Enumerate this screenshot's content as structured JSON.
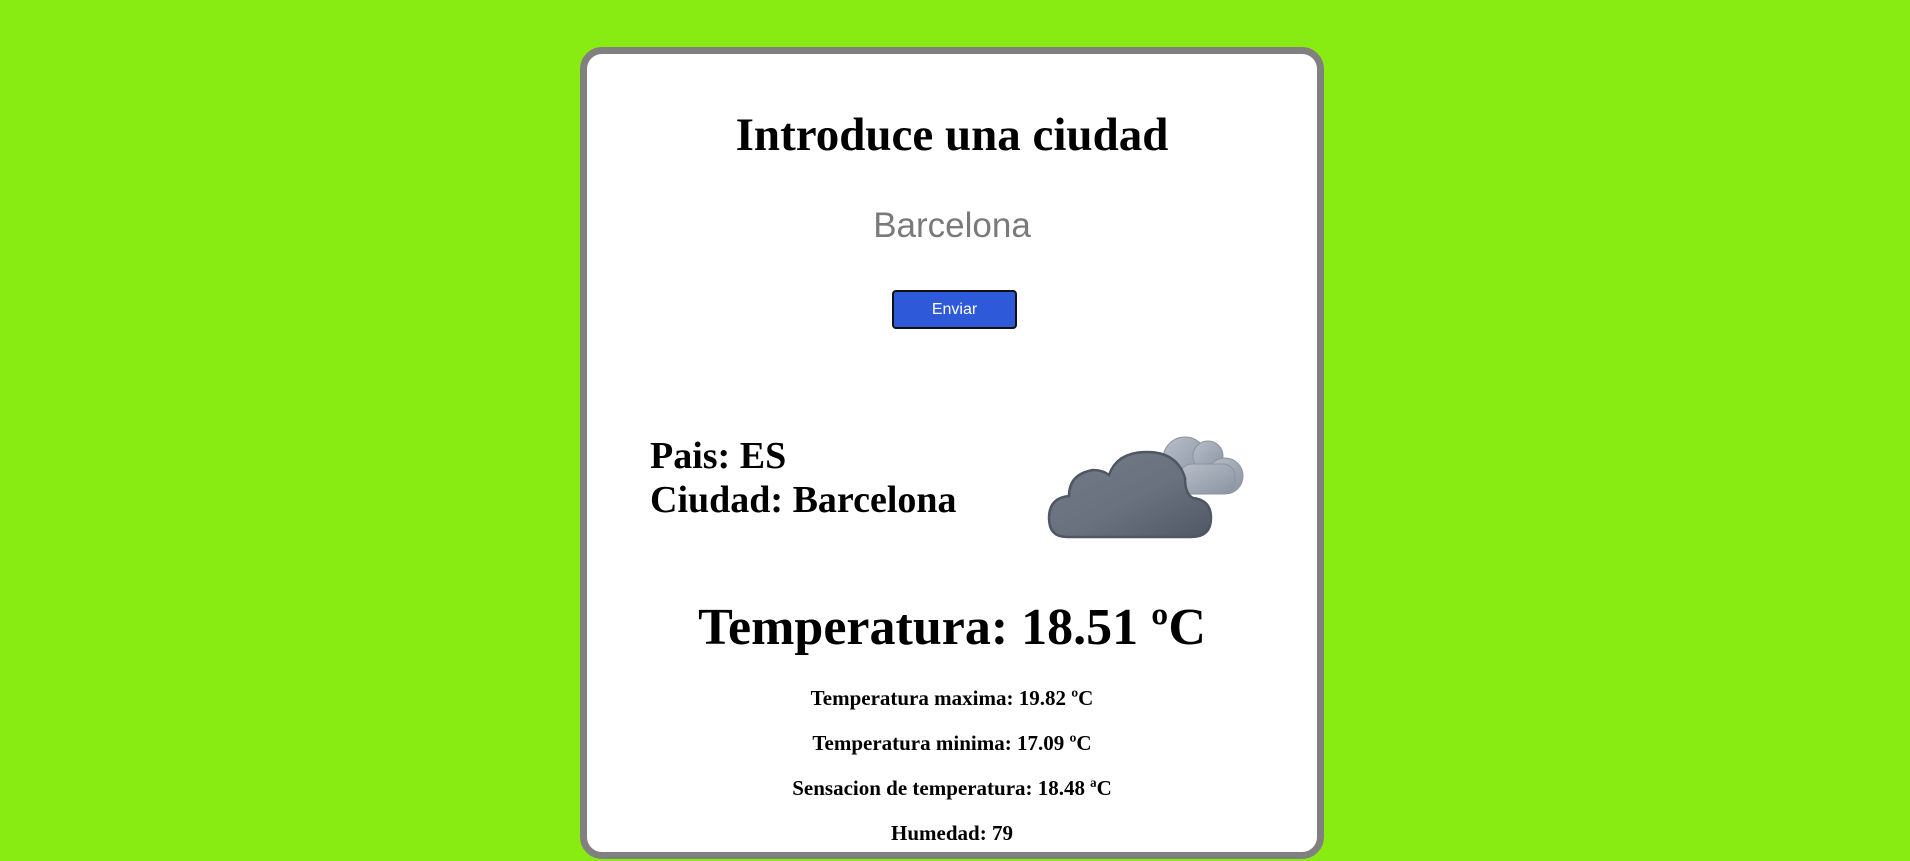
{
  "form": {
    "title": "Introduce una ciudad",
    "city_value": "Barcelona",
    "city_placeholder": "",
    "submit_label": "Enviar"
  },
  "location": {
    "country_label": "Pais:",
    "country": "ES",
    "city_label": "Ciudad:",
    "city": "Barcelona"
  },
  "weather": {
    "icon": "cloudy-icon",
    "temperature_label": "Temperatura:",
    "temperature": "18.51",
    "temperature_unit": "ºC",
    "max_label": "Temperatura maxima:",
    "max": "19.82",
    "max_unit": "ºC",
    "min_label": "Temperatura minima:",
    "min": "17.09",
    "min_unit": "ºC",
    "feels_label": "Sensacion de temperatura:",
    "feels": "18.48",
    "feels_unit": "ªC",
    "humidity_label": "Humedad:",
    "humidity": "79"
  },
  "colors": {
    "background": "#88ec12",
    "card_border": "#808080",
    "button": "#2e59d9"
  }
}
